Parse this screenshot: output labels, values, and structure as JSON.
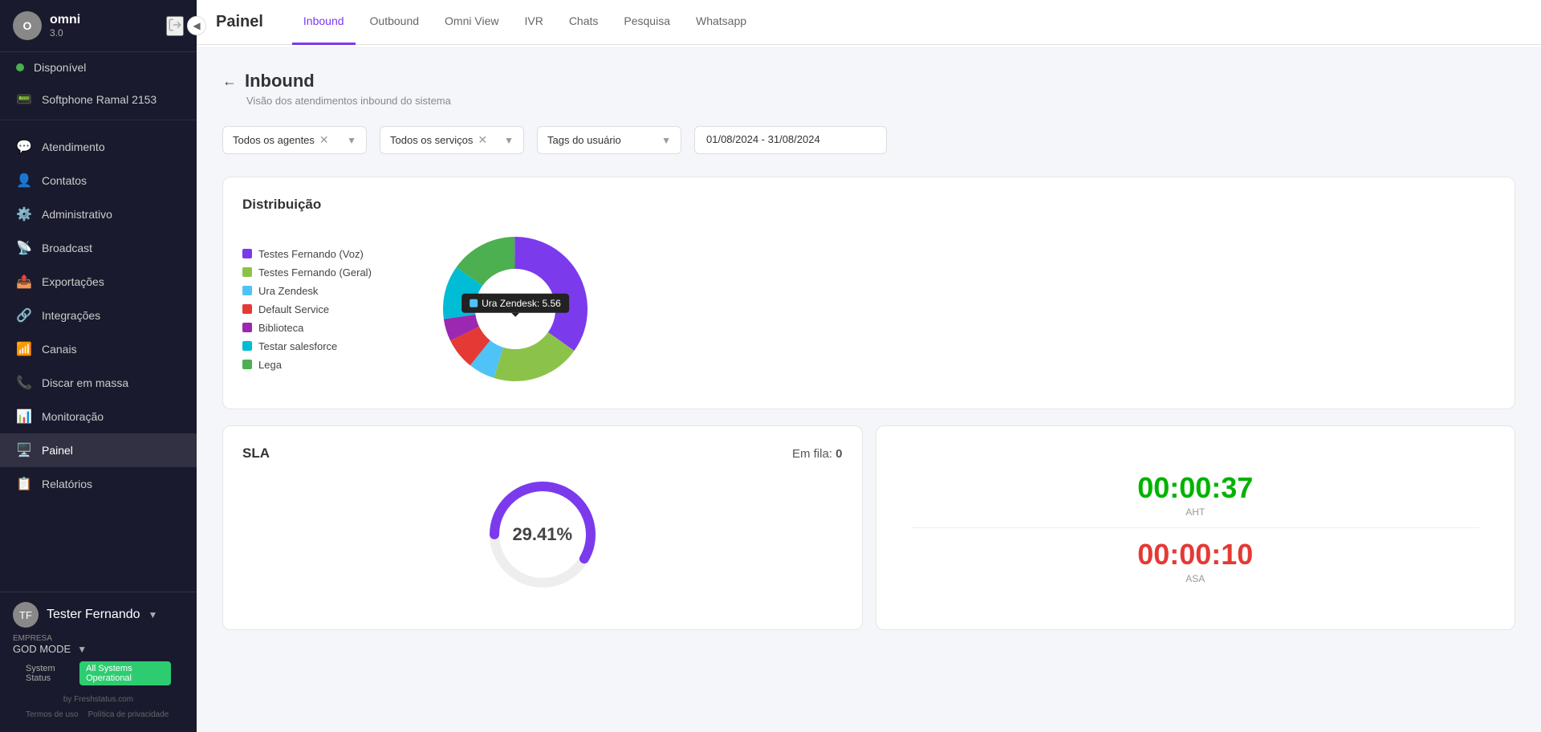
{
  "sidebar": {
    "brand": {
      "name": "omni",
      "version": "3.0"
    },
    "status": {
      "label": "Disponível",
      "color": "#4caf50"
    },
    "softphone": "Softphone Ramal 2153",
    "nav_items": [
      {
        "id": "atendimento",
        "label": "Atendimento",
        "icon": "💬"
      },
      {
        "id": "contatos",
        "label": "Contatos",
        "icon": "👤"
      },
      {
        "id": "administrativo",
        "label": "Administrativo",
        "icon": "⚙️"
      },
      {
        "id": "broadcast",
        "label": "Broadcast",
        "icon": "📡"
      },
      {
        "id": "exportacoes",
        "label": "Exportações",
        "icon": "📤"
      },
      {
        "id": "integracoes",
        "label": "Integrações",
        "icon": "🔗"
      },
      {
        "id": "canais",
        "label": "Canais",
        "icon": "📶"
      },
      {
        "id": "discar-em-massa",
        "label": "Discar em massa",
        "icon": "📞"
      },
      {
        "id": "monitoracao",
        "label": "Monitoração",
        "icon": "📊"
      },
      {
        "id": "painel",
        "label": "Painel",
        "icon": "🖥️",
        "active": true
      },
      {
        "id": "relatorios",
        "label": "Relatórios",
        "icon": "📋"
      }
    ],
    "user": {
      "name": "Tester Fernando",
      "initials": "TF"
    },
    "company_label": "EMPRESA",
    "company_name": "GOD MODE",
    "system_status_label": "System Status",
    "system_status_badge": "All Systems Operational",
    "powered_by": "by Freshstatus.com",
    "footer_links": [
      "Termos de uso",
      "Política de privacidade"
    ]
  },
  "topbar": {
    "title": "Painel",
    "tabs": [
      {
        "id": "inbound",
        "label": "Inbound",
        "active": true
      },
      {
        "id": "outbound",
        "label": "Outbound"
      },
      {
        "id": "omni-view",
        "label": "Omni View"
      },
      {
        "id": "ivr",
        "label": "IVR"
      },
      {
        "id": "chats",
        "label": "Chats"
      },
      {
        "id": "pesquisa",
        "label": "Pesquisa"
      },
      {
        "id": "whatsapp",
        "label": "Whatsapp"
      }
    ]
  },
  "page": {
    "title": "Inbound",
    "subtitle": "Visão dos atendimentos inbound do sistema",
    "filters": {
      "agents_label": "Todos os agentes",
      "services_label": "Todos os serviços",
      "tags_label": "Tags do usuário",
      "date_value": "01/08/2024 - 31/08/2024"
    },
    "distribution": {
      "title": "Distribuição",
      "legend": [
        {
          "label": "Testes Fernando (Voz)",
          "color": "#7c3aed"
        },
        {
          "label": "Testes Fernando (Geral)",
          "color": "#8bc34a"
        },
        {
          "label": "Ura Zendesk",
          "color": "#4fc3f7"
        },
        {
          "label": "Default Service",
          "color": "#e53935"
        },
        {
          "label": "Biblioteca",
          "color": "#9c27b0"
        },
        {
          "label": "Testar salesforce",
          "color": "#00bcd4"
        },
        {
          "label": "Lega",
          "color": "#4caf50"
        }
      ],
      "tooltip": {
        "label": "Ura Zendesk:",
        "value": "5.56",
        "color": "#4fc3f7"
      },
      "donut": {
        "segments": [
          {
            "color": "#7c3aed",
            "value": 35,
            "startAngle": 0
          },
          {
            "color": "#8bc34a",
            "value": 20,
            "startAngle": 126
          },
          {
            "color": "#4fc3f7",
            "value": 6,
            "startAngle": 198
          },
          {
            "color": "#e53935",
            "value": 7,
            "startAngle": 220
          },
          {
            "color": "#9c27b0",
            "value": 5,
            "startAngle": 245
          },
          {
            "color": "#00bcd4",
            "value": 12,
            "startAngle": 263
          },
          {
            "color": "#4caf50",
            "value": 15,
            "startAngle": 306
          }
        ]
      }
    },
    "sla": {
      "title": "SLA",
      "em_fila_label": "Em fila:",
      "em_fila_value": "0",
      "percentage": "29.41",
      "percentage_suffix": "%"
    },
    "timers": {
      "aht_value": "00:00:37",
      "aht_label": "AHT",
      "asa_value": "00:00:10",
      "asa_label": "ASA"
    }
  }
}
